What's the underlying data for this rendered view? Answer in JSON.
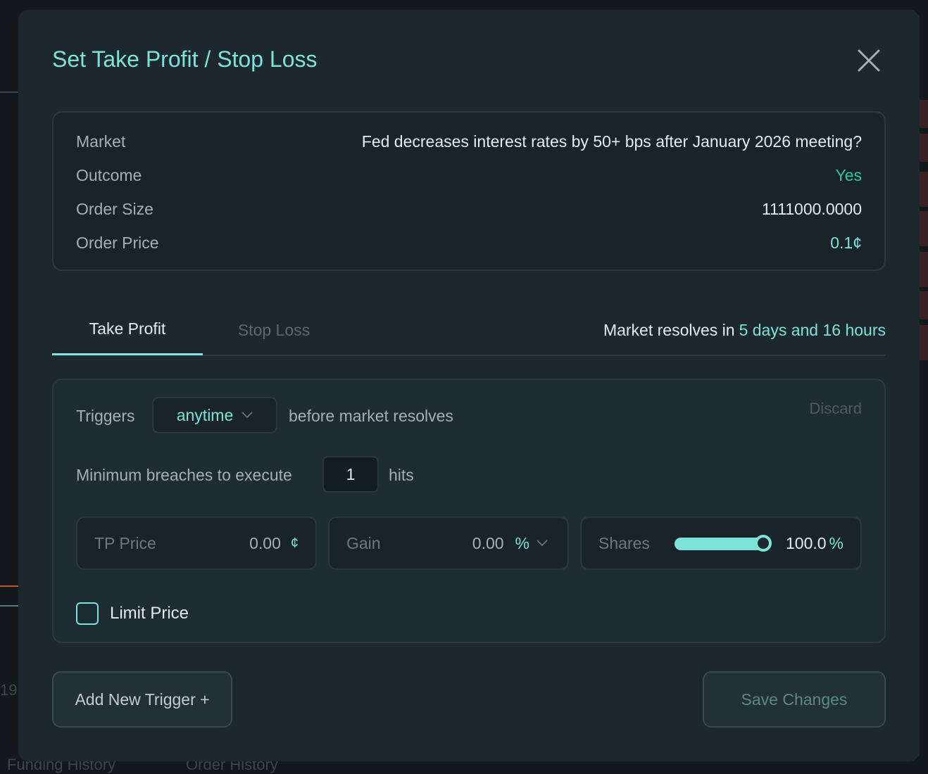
{
  "background": {
    "tabs": [
      "Funding History",
      "Order History"
    ],
    "axis_label": "19"
  },
  "modal": {
    "title": "Set Take Profit / Stop Loss",
    "close_icon": "close-icon"
  },
  "info": {
    "rows": [
      {
        "label": "Market",
        "value": "Fed decreases interest rates by 50+ bps after January 2026 meeting?"
      },
      {
        "label": "Outcome",
        "value": "Yes"
      },
      {
        "label": "Order Size",
        "value": "1111000.0000"
      },
      {
        "label": "Order Price",
        "value": "0.1¢"
      }
    ]
  },
  "tabs": {
    "items": [
      {
        "label": "Take Profit",
        "active": true
      },
      {
        "label": "Stop Loss",
        "active": false
      }
    ],
    "resolves_prefix": "Market resolves in",
    "resolves_time": "5 days and 16 hours"
  },
  "trigger": {
    "triggers_label": "Triggers",
    "timing_value": "anytime",
    "timing_suffix": "before market resolves",
    "discard_label": "Discard",
    "breaches_label": "Minimum breaches to execute",
    "breaches_value": "1",
    "breaches_unit": "hits",
    "tp_price": {
      "label": "TP Price",
      "value": "0.00",
      "unit": "¢"
    },
    "gain": {
      "label": "Gain",
      "value": "0.00",
      "unit": "%"
    },
    "shares": {
      "label": "Shares",
      "value": "100.0",
      "unit": "%",
      "fraction": 1.0
    },
    "limit_price_label": "Limit Price",
    "limit_price_checked": false
  },
  "footer": {
    "add_trigger_label": "Add New Trigger +",
    "save_label": "Save Changes"
  },
  "colors": {
    "accent": "#7de3d9",
    "positive": "#2ec99a",
    "modal_bg": "#1c282e"
  }
}
